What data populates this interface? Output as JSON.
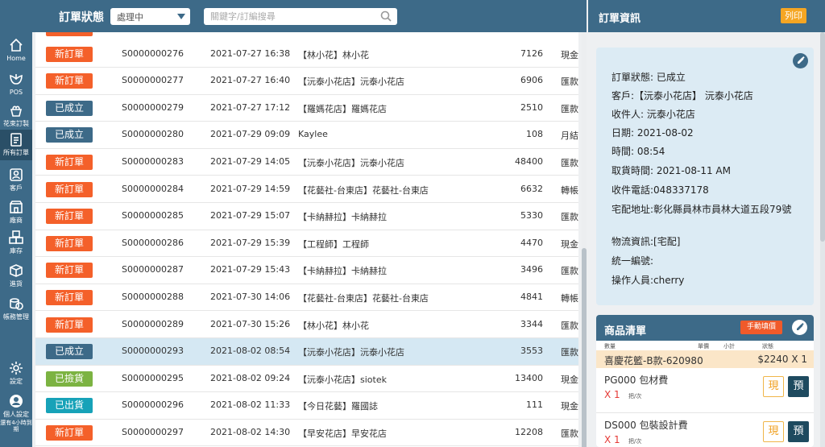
{
  "sidebar": {
    "items": [
      {
        "label": "Home",
        "icon": "home-icon"
      },
      {
        "label": "POS",
        "icon": "flower-icon"
      },
      {
        "label": "花束訂製",
        "icon": "bouquet-icon"
      },
      {
        "label": "所有訂單",
        "icon": "clipboard-icon"
      },
      {
        "label": "客戶",
        "icon": "customer-icon"
      },
      {
        "label": "廠商",
        "icon": "vendor-icon"
      },
      {
        "label": "庫存",
        "icon": "boxes-icon"
      },
      {
        "label": "進貨",
        "icon": "box-icon"
      },
      {
        "label": "帳務管理",
        "icon": "coins-icon"
      },
      {
        "label": "設定",
        "icon": "gear-icon"
      },
      {
        "label": "個人設定",
        "icon": "user-icon"
      }
    ],
    "note": "還有4小時到期"
  },
  "topbar": {
    "status_label": "訂單狀態",
    "status_value": "處理中",
    "search_placeholder": "關鍵字/訂編搜尋"
  },
  "colors": {
    "primary": "#3d6a88",
    "new_order": "#f4602a",
    "established": "#3d6a88",
    "checked": "#7cb342",
    "shipped": "#17a2b8",
    "print": "#f5a623"
  },
  "orders": [
    {
      "status": "新訂單",
      "status_key": "new",
      "id": "S0000000276",
      "date": "2021-07-27 16:38",
      "customer": "【林小花】林小花",
      "amount": "7126",
      "payment": "現金"
    },
    {
      "status": "新訂單",
      "status_key": "new",
      "id": "S0000000277",
      "date": "2021-07-27 16:40",
      "customer": "【沅泰小花店】沅泰小花店",
      "amount": "6906",
      "payment": "匯款"
    },
    {
      "status": "已成立",
      "status_key": "established",
      "id": "S0000000279",
      "date": "2021-07-27 17:12",
      "customer": "【羅媽花店】羅媽花店",
      "amount": "2510",
      "payment": "匯款"
    },
    {
      "status": "已成立",
      "status_key": "established",
      "id": "S0000000280",
      "date": "2021-07-29 09:09",
      "customer": "Kaylee",
      "amount": "108",
      "payment": "月結"
    },
    {
      "status": "新訂單",
      "status_key": "new",
      "id": "S0000000283",
      "date": "2021-07-29 14:05",
      "customer": "【沅泰小花店】沅泰小花店",
      "amount": "48400",
      "payment": "匯款"
    },
    {
      "status": "新訂單",
      "status_key": "new",
      "id": "S0000000284",
      "date": "2021-07-29 14:59",
      "customer": "【花藝社-台東店】花藝社-台東店",
      "amount": "6632",
      "payment": "轉帳"
    },
    {
      "status": "新訂單",
      "status_key": "new",
      "id": "S0000000285",
      "date": "2021-07-29 15:07",
      "customer": "【卡納赫拉】卡納赫拉",
      "amount": "5330",
      "payment": "匯款"
    },
    {
      "status": "新訂單",
      "status_key": "new",
      "id": "S0000000286",
      "date": "2021-07-29 15:39",
      "customer": "【工程師】工程師",
      "amount": "4470",
      "payment": "現金"
    },
    {
      "status": "新訂單",
      "status_key": "new",
      "id": "S0000000287",
      "date": "2021-07-29 15:43",
      "customer": "【卡納赫拉】卡納赫拉",
      "amount": "3496",
      "payment": "匯款"
    },
    {
      "status": "新訂單",
      "status_key": "new",
      "id": "S0000000288",
      "date": "2021-07-30 14:06",
      "customer": "【花藝社-台東店】花藝社-台東店",
      "amount": "4841",
      "payment": "轉帳"
    },
    {
      "status": "新訂單",
      "status_key": "new",
      "id": "S0000000289",
      "date": "2021-07-30 15:26",
      "customer": "【林小花】林小花",
      "amount": "3344",
      "payment": "匯款"
    },
    {
      "status": "已成立",
      "status_key": "established",
      "id": "S0000000293",
      "date": "2021-08-02 08:54",
      "customer": "【沅泰小花店】沅泰小花店",
      "amount": "3553",
      "payment": "匯款",
      "selected": true
    },
    {
      "status": "已撿貨",
      "status_key": "checked",
      "id": "S0000000295",
      "date": "2021-08-02 09:24",
      "customer": "【沅泰小花店】siotek",
      "amount": "13400",
      "payment": "現金"
    },
    {
      "status": "已出貨",
      "status_key": "shipped",
      "id": "S0000000296",
      "date": "2021-08-02 11:33",
      "customer": "【今日花藝】羅國誌",
      "amount": "111",
      "payment": "現金"
    },
    {
      "status": "新訂單",
      "status_key": "new",
      "id": "S0000000297",
      "date": "2021-08-02 14:30",
      "customer": "【早安花店】早安花店",
      "amount": "12208",
      "payment": "匯款"
    }
  ],
  "right_panel": {
    "title": "訂單資訊",
    "print_label": "列印",
    "info": [
      "訂單狀態: 已成立",
      "客戶:【沅泰小花店】 沅泰小花店",
      "收件人: 沅泰小花店",
      "日期: 2021-08-02",
      "時間: 08:54",
      "取貨時間: 2021-08-11 AM",
      "收件電話:048337178",
      "宅配地址:彰化縣員林市員林大道五段79號",
      "物流資訊:[宅配]",
      "統一編號:",
      "操作人員:cherry"
    ],
    "products": {
      "title": "商品清單",
      "manual_price_label": "手動填價",
      "col_qty": "數量",
      "col_unit_price": "單價",
      "col_subtotal": "小計",
      "col_status": "狀態",
      "highlight_name": "喜慶花籃-B款-620980",
      "highlight_price": "$2240 X 1",
      "items": [
        {
          "name": "PG000 包材費",
          "qty": "X 1",
          "unit": "把/次",
          "cash": "現",
          "pre": "預"
        },
        {
          "name": "DS000 包裝設計費",
          "qty": "X 1",
          "unit": "把/次",
          "cash": "現",
          "pre": "預"
        }
      ]
    }
  }
}
